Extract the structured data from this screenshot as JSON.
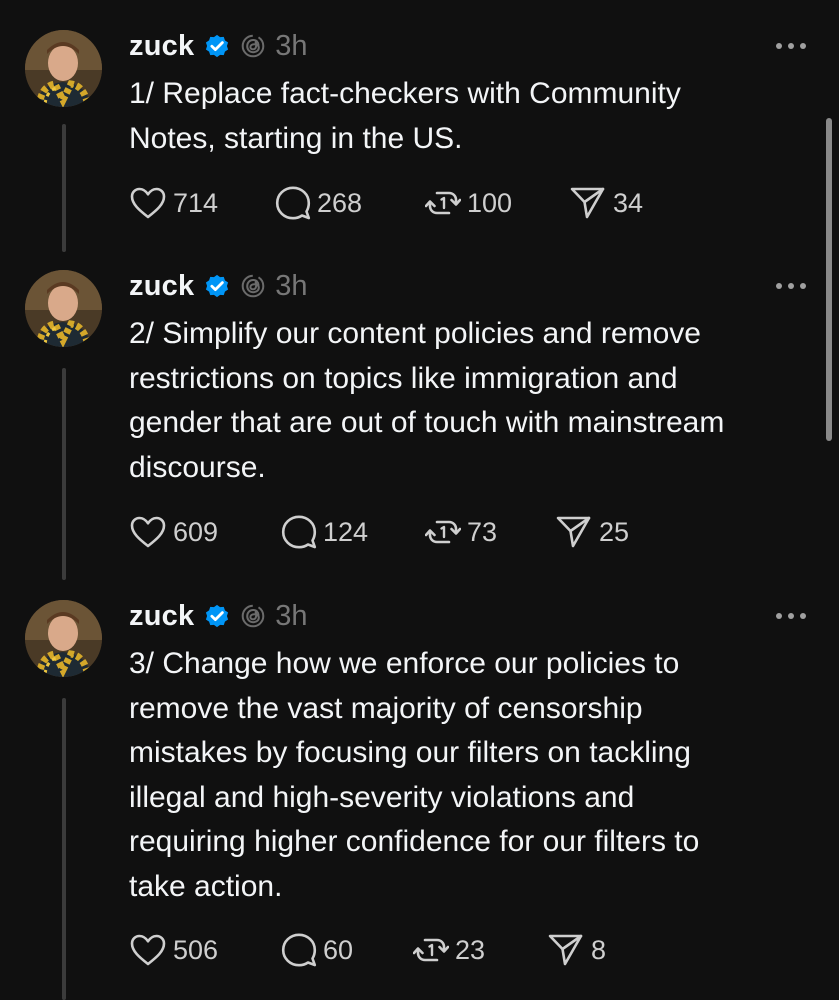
{
  "posts": [
    {
      "username": "zuck",
      "time": "3h",
      "text": "1/ Replace fact-checkers with Community\nNotes, starting in the US.",
      "likes": "714",
      "replies": "268",
      "reposts": "100",
      "shares": "34"
    },
    {
      "username": "zuck",
      "time": "3h",
      "text": "2/ Simplify our content policies and remove\nrestrictions on topics like immigration and\ngender that are out of touch with mainstream\ndiscourse.",
      "likes": "609",
      "replies": "124",
      "reposts": "73",
      "shares": "25"
    },
    {
      "username": "zuck",
      "time": "3h",
      "text": "3/ Change how we enforce our policies to\nremove the vast majority of censorship\nmistakes by focusing our filters on tackling\nillegal and high-severity violations and\nrequiring higher confidence for our filters to\ntake action.",
      "likes": "506",
      "replies": "60",
      "reposts": "23",
      "shares": "8"
    }
  ],
  "icons": {
    "verified": "verified-badge-icon",
    "threads": "threads-logo-icon",
    "more": "more-options-icon",
    "like": "heart-icon",
    "reply": "comment-icon",
    "repost": "repost-icon",
    "share": "send-icon"
  },
  "colors": {
    "background": "#101010",
    "text": "#f3f5f7",
    "muted": "#777777",
    "verified": "#0095f6",
    "thread_line": "#3b3b3b"
  }
}
